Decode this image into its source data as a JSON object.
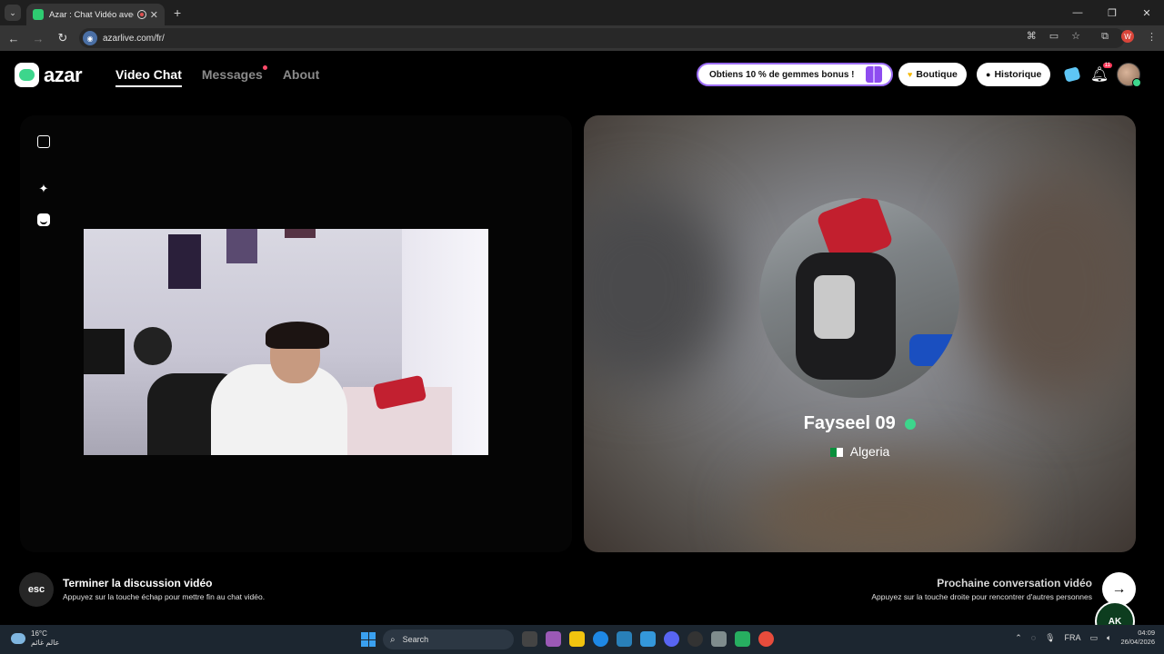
{
  "browser": {
    "tab_title": "Azar : Chat Vidéo avec de n",
    "tab_close": "✕",
    "new_tab": "+",
    "url": "azarlive.com/fr/",
    "profile_initial": "W",
    "window_controls": [
      "—",
      "❐",
      "✕"
    ]
  },
  "app": {
    "logo_text": "azar",
    "nav": {
      "video_chat": "Video Chat",
      "messages": "Messages",
      "about": "About"
    },
    "promo_label": "Obtiens 10 % de gemmes bonus !",
    "shop_label": "Boutique",
    "history_label": "Historique",
    "notification_count": "11",
    "accent_color": "#3dd68c",
    "promo_border_color": "#9b6cf5"
  },
  "match": {
    "name": "Fayseel 09",
    "country": "Algeria"
  },
  "footer": {
    "esc_key": "esc",
    "end_title": "Terminer la discussion vidéo",
    "end_subtitle": "Appuyez sur la touche échap pour mettre fin au chat vidéo.",
    "next_title": "Prochaine conversation vidéo",
    "next_subtitle": "Appuyez sur la touche droite pour rencontrer d'autres personnes",
    "next_arrow": "→",
    "watermark": "AK"
  },
  "taskbar": {
    "temperature": "16°C",
    "weather_text": "عالم غائم",
    "search_placeholder": "Search",
    "language": "FRA",
    "time": "04:09",
    "date": "26/04/2026"
  }
}
